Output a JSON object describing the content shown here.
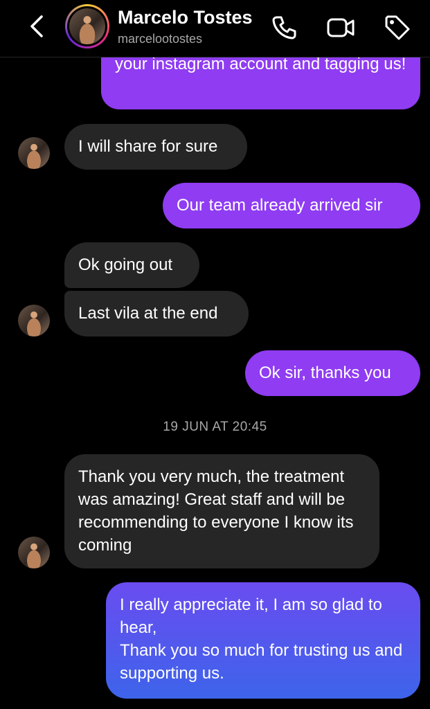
{
  "header": {
    "name": "Marcelo Tostes",
    "username": "marcelootostes",
    "icons": [
      "back-chevron-icon",
      "phone-icon",
      "video-camera-icon",
      "tag-icon"
    ]
  },
  "messages": {
    "m1": "your instagram account and tagging us!",
    "m2": "I will share for sure",
    "m3": "Our team already arrived sir",
    "m4": "Ok going out",
    "m5": "Last vila at the end",
    "m6": "Ok sir, thanks you",
    "timestamp": "19 JUN AT 20:45",
    "m7": "Thank you very much, the treatment was amazing! Great staff and will be recommending to everyone I know its coming",
    "m8_line1": "I really appreciate it, I am so glad to hear,",
    "m8_line2": "Thank you so much for trusting us and supporting us."
  },
  "colors": {
    "background": "#000000",
    "incoming_bubble": "#262626",
    "outgoing_bubble": "#8f3cf2",
    "outgoing_bubble_gradient": [
      "#6a4cf0",
      "#3d64ea"
    ],
    "secondary_text": "#a8a8a8"
  }
}
